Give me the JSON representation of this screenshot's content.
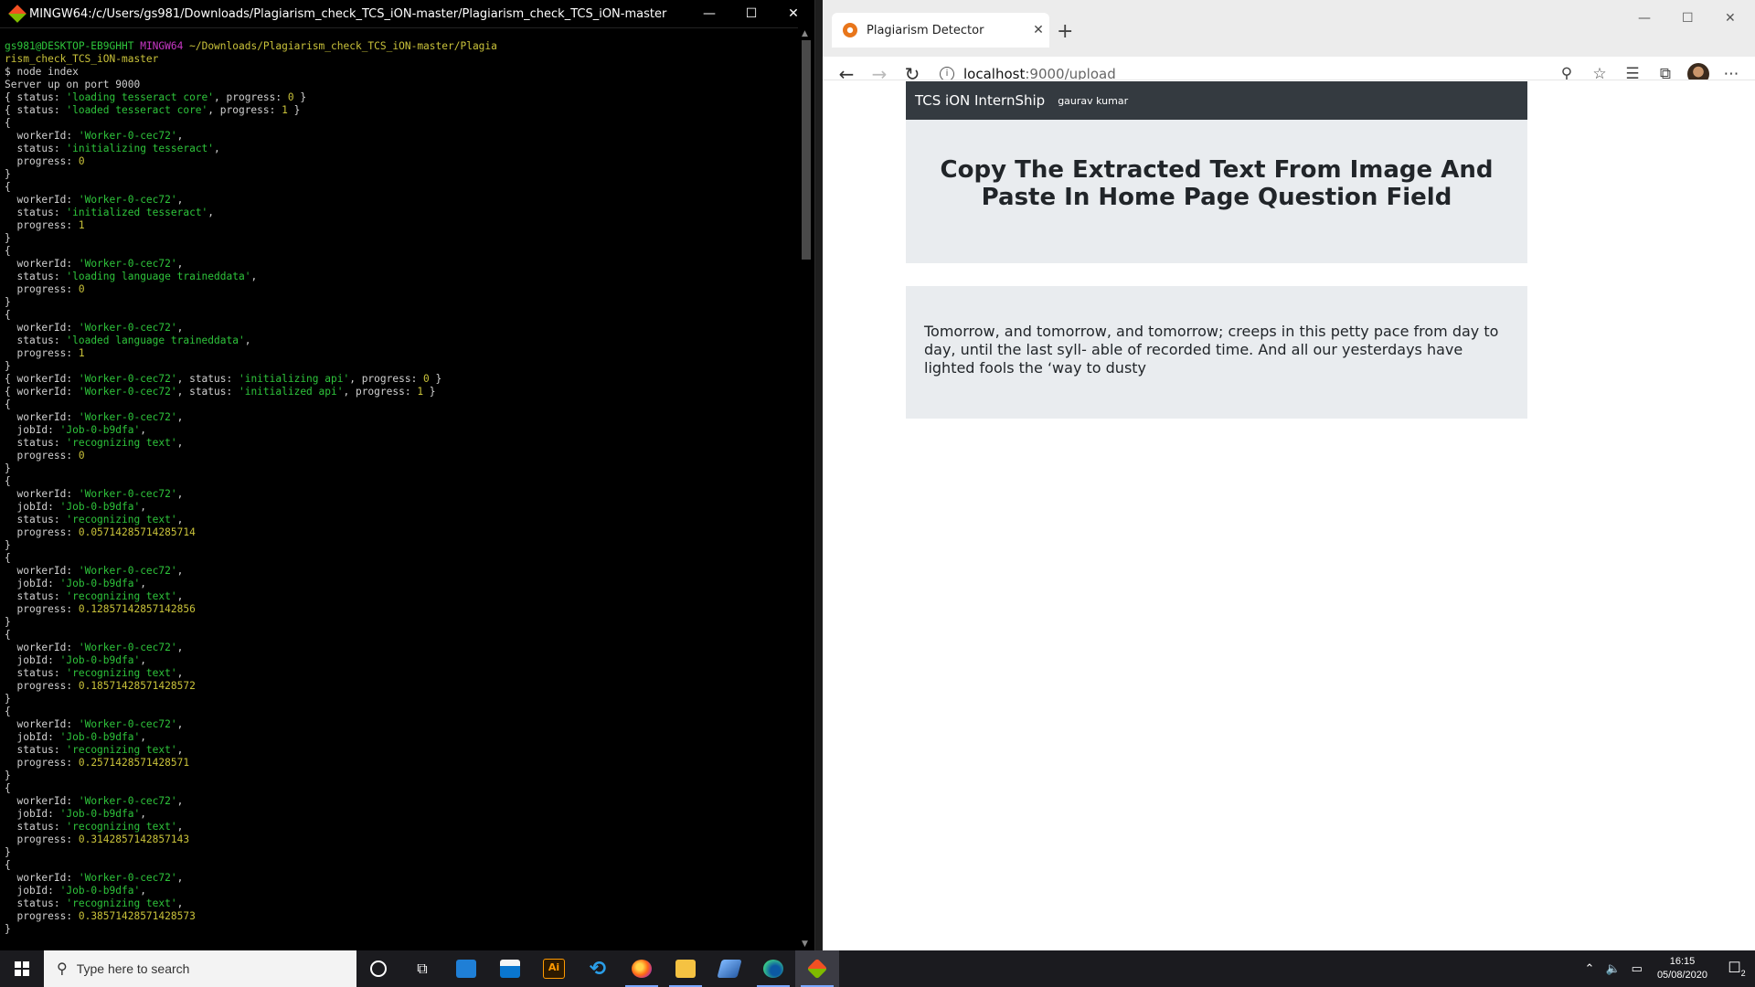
{
  "terminal": {
    "title": "MINGW64:/c/Users/gs981/Downloads/Plagiarism_check_TCS_iON-master/Plagiarism_check_TCS_iON-master",
    "prompt_user": "gs981@DESKTOP-EB9GHHT",
    "prompt_env": "MINGW64",
    "prompt_path_1": "~/Downloads/Plagiarism_check_TCS_iON-master/Plagia",
    "prompt_path_2": "rism_check_TCS_iON-master",
    "command": "$ node index",
    "server_line": "Server up on port 9000",
    "status_line_1": {
      "pre": "{ status: ",
      "str": "'loading tesseract core'",
      "mid": ", progress: ",
      "num": "0",
      "post": " }"
    },
    "status_line_2": {
      "pre": "{ status: ",
      "str": "'loaded tesseract core'",
      "mid": ", progress: ",
      "num": "1",
      "post": " }"
    },
    "worker_blocks": [
      {
        "workerId": "'Worker-0-cec72'",
        "status": "'initializing tesseract'",
        "progress": "0"
      },
      {
        "workerId": "'Worker-0-cec72'",
        "status": "'initialized tesseract'",
        "progress": "1"
      },
      {
        "workerId": "'Worker-0-cec72'",
        "status": "'loading language traineddata'",
        "progress": "0"
      },
      {
        "workerId": "'Worker-0-cec72'",
        "status": "'loaded language traineddata'",
        "progress": "1"
      }
    ],
    "api_line_1": {
      "w": "'Worker-0-cec72'",
      "s": "'initializing api'",
      "p": "0"
    },
    "api_line_2": {
      "w": "'Worker-0-cec72'",
      "s": "'initialized api'",
      "p": "1"
    },
    "job_blocks": [
      {
        "workerId": "'Worker-0-cec72'",
        "jobId": "'Job-0-b9dfa'",
        "status": "'recognizing text'",
        "progress": "0"
      },
      {
        "workerId": "'Worker-0-cec72'",
        "jobId": "'Job-0-b9dfa'",
        "status": "'recognizing text'",
        "progress": "0.05714285714285714"
      },
      {
        "workerId": "'Worker-0-cec72'",
        "jobId": "'Job-0-b9dfa'",
        "status": "'recognizing text'",
        "progress": "0.12857142857142856"
      },
      {
        "workerId": "'Worker-0-cec72'",
        "jobId": "'Job-0-b9dfa'",
        "status": "'recognizing text'",
        "progress": "0.18571428571428572"
      },
      {
        "workerId": "'Worker-0-cec72'",
        "jobId": "'Job-0-b9dfa'",
        "status": "'recognizing text'",
        "progress": "0.2571428571428571"
      },
      {
        "workerId": "'Worker-0-cec72'",
        "jobId": "'Job-0-b9dfa'",
        "status": "'recognizing text'",
        "progress": "0.3142857142857143"
      },
      {
        "workerId": "'Worker-0-cec72'",
        "jobId": "'Job-0-b9dfa'",
        "status": "'recognizing text'",
        "progress": "0.38571428571428573"
      }
    ],
    "keys": {
      "workerId": "workerId: ",
      "jobId": "jobId: ",
      "status": "status: ",
      "progress": "progress: "
    }
  },
  "browser": {
    "tab_title": "Plagiarism Detector",
    "url_host": "localhost",
    "url_path": ":9000/upload",
    "navbar_brand": "TCS iON InternShip",
    "navbar_link": "gaurav kumar",
    "heading": "Copy The Extracted Text From Image And Paste In Home Page Question Field",
    "extracted_text": "Tomorrow, and tomorrow, and tomorrow; creeps in this petty pace from day to day, until the last syll- able of recorded time. And all our yesterdays have lighted fools the ‘way to dusty"
  },
  "taskbar": {
    "search_placeholder": "Type here to search",
    "time": "16:15",
    "date": "05/08/2020",
    "notification_count": "2"
  },
  "colors": {
    "terminal_green": "#2ec43b",
    "terminal_yellow": "#c9c23a",
    "navbar_bg": "#343a40",
    "jumbotron_bg": "#e9ecef"
  }
}
